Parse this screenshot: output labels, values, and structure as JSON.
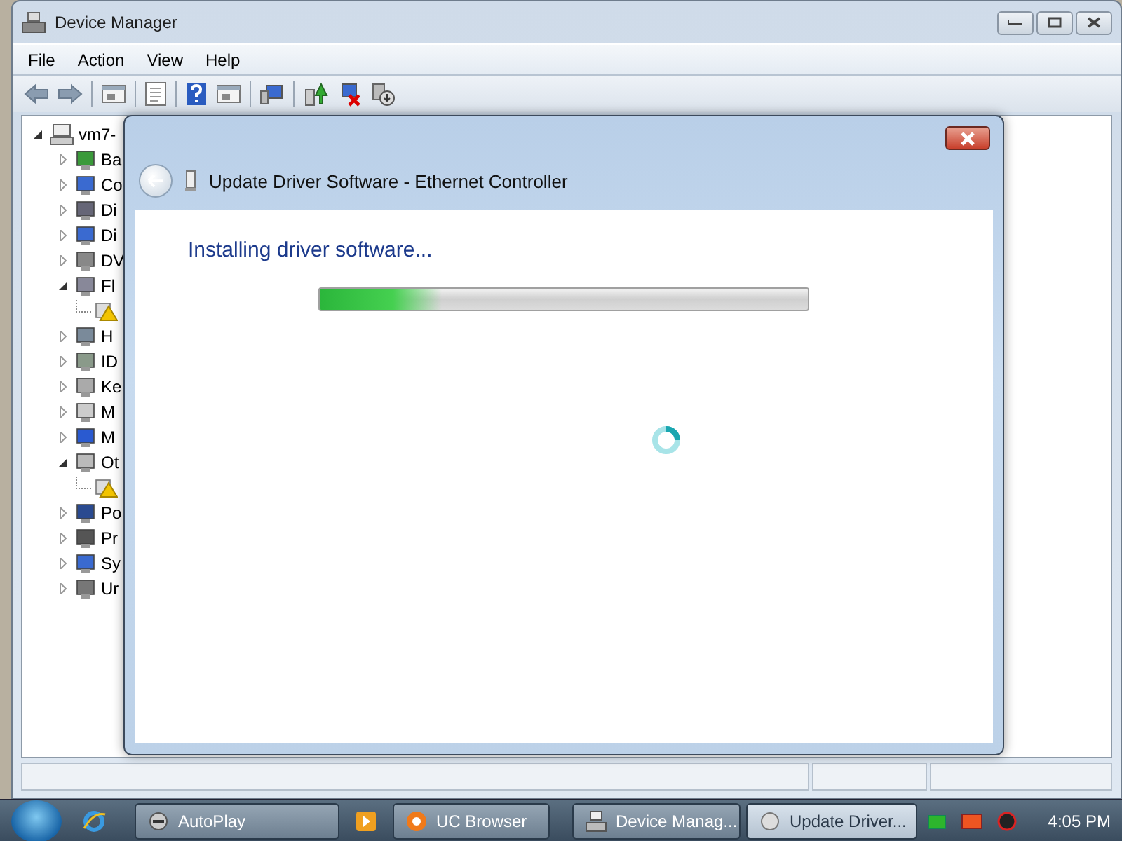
{
  "window": {
    "title": "Device Manager"
  },
  "menu": [
    "File",
    "Action",
    "View",
    "Help"
  ],
  "tree": {
    "label": "vm7-",
    "expanded": true,
    "children": [
      {
        "label": "Ba",
        "expanded": false
      },
      {
        "label": "Co",
        "expanded": false
      },
      {
        "label": "Di",
        "expanded": false
      },
      {
        "label": "Di",
        "expanded": false
      },
      {
        "label": "DV",
        "expanded": false
      },
      {
        "label": "Fl",
        "expanded": true,
        "children": [
          {
            "kind": "warning-device"
          }
        ]
      },
      {
        "label": "H",
        "expanded": false
      },
      {
        "label": "ID",
        "expanded": false
      },
      {
        "label": "Ke",
        "expanded": false
      },
      {
        "label": "M",
        "expanded": false
      },
      {
        "label": "M",
        "expanded": false
      },
      {
        "label": "Ot",
        "expanded": true,
        "children": [
          {
            "kind": "warning-device"
          }
        ]
      },
      {
        "label": "Po",
        "expanded": false
      },
      {
        "label": "Pr",
        "expanded": false
      },
      {
        "label": "Sy",
        "expanded": false
      },
      {
        "label": "Ur",
        "expanded": false
      }
    ]
  },
  "dialog": {
    "title": "Update Driver Software - Ethernet Controller",
    "heading": "Installing driver software...",
    "progress": {
      "level": 0.25
    }
  },
  "taskbar": {
    "buttons": [
      {
        "label": "AutoPlay",
        "selected": false
      },
      {
        "label": "UC Browser",
        "selected": false
      },
      {
        "label": "Device Manag...",
        "selected": false
      },
      {
        "label": "Update Driver...",
        "selected": true
      }
    ],
    "clock": "4:05 PM"
  }
}
